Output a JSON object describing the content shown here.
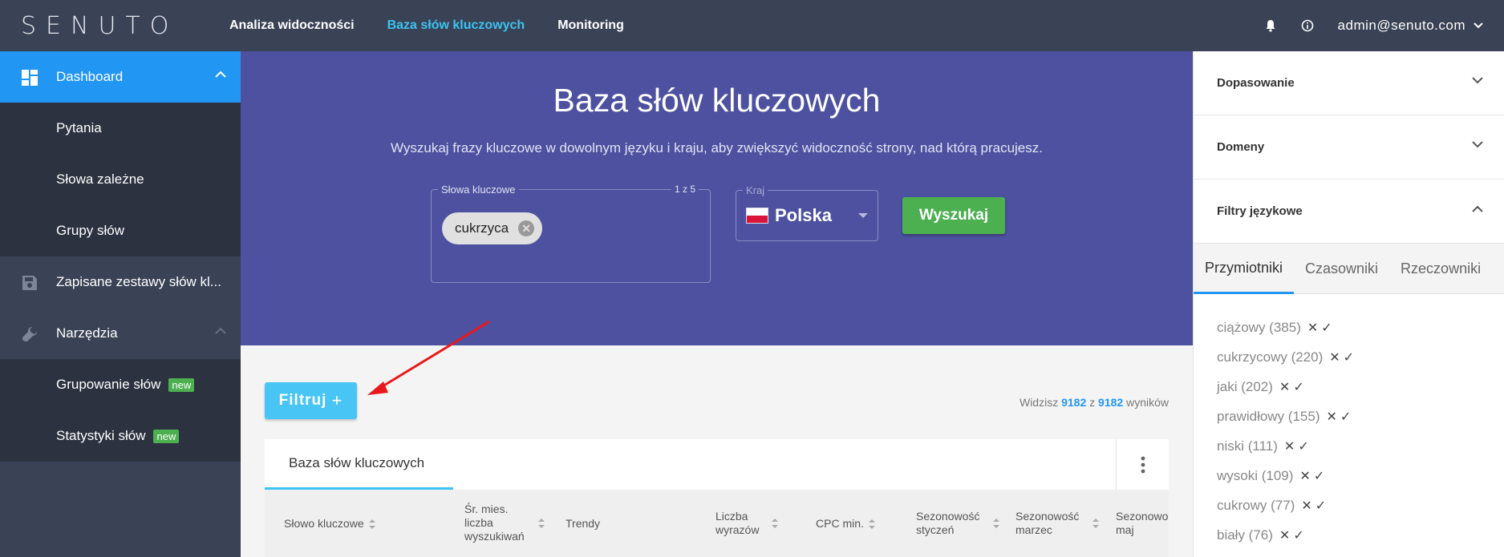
{
  "logo": {
    "text": "SENUTO"
  },
  "nav": {
    "items": [
      "Analiza widoczności",
      "Baza słów kluczowych",
      "Monitoring"
    ],
    "active_index": 1
  },
  "header": {
    "user_email": "admin@senuto.com"
  },
  "sidebar": {
    "dashboard": "Dashboard",
    "sub_dashboard": [
      "Pytania",
      "Słowa zależne",
      "Grupy słów"
    ],
    "saved": "Zapisane zestawy słów kl...",
    "tools": "Narzędzia",
    "sub_tools": [
      "Grupowanie słów",
      "Statystyki słów"
    ],
    "badge": "new"
  },
  "hero": {
    "title": "Baza słów kluczowych",
    "subtitle": "Wyszukaj frazy kluczowe w dowolnym języku i kraju, aby zwiększyć widoczność strony, nad którą pracujesz.",
    "keywords_label": "Słowa kluczowe",
    "keywords_count": "1 z 5",
    "chip": "cukrzyca",
    "country_label": "Kraj",
    "country": "Polska",
    "search_button": "Wyszukaj"
  },
  "content": {
    "filter_button": "Filtruj",
    "results_prefix": "Widzisz",
    "results_shown": "9182",
    "results_mid": "z",
    "results_total": "9182",
    "results_suffix": "wyników",
    "panel_tab": "Baza słów kluczowych",
    "columns": [
      "Słowo kluczowe",
      "Śr. mies. liczba wyszukiwań",
      "Trendy",
      "Liczba wyrazów",
      "CPC min.",
      "Sezonowość styczeń",
      "Sezonowość marzec",
      "Sezonowość maj"
    ]
  },
  "right_panel": {
    "accordions": [
      "Dopasowanie",
      "Domeny",
      "Filtry językowe"
    ],
    "tabs": [
      "Przymiotniki",
      "Czasowniki",
      "Rzeczowniki"
    ],
    "filters": [
      "ciążowy (385)",
      "cukrzycowy (220)",
      "jaki (202)",
      "prawidłowy (155)",
      "niski (111)",
      "wysoki (109)",
      "cukrowy (77)",
      "biały (76)"
    ],
    "exclude_symbol": "✕",
    "include_symbol": "✓"
  },
  "colors": {
    "topbar": "#3a4256",
    "hero": "#4d51a0",
    "accent": "#3cc3f2",
    "active_sidebar": "#2196f3",
    "search_button": "#4caf50",
    "filter_button": "#48c5f5",
    "annotation_arrow": "#e8191c"
  },
  "icons": {
    "bell": "bell-icon",
    "info": "info-icon",
    "dashboard": "dashboard-grid-icon",
    "save": "save-icon",
    "wrench": "wrench-icon",
    "chevron_up": "chevron-up-icon",
    "chevron_down": "chevron-down-icon",
    "more": "more-vertical-icon"
  }
}
